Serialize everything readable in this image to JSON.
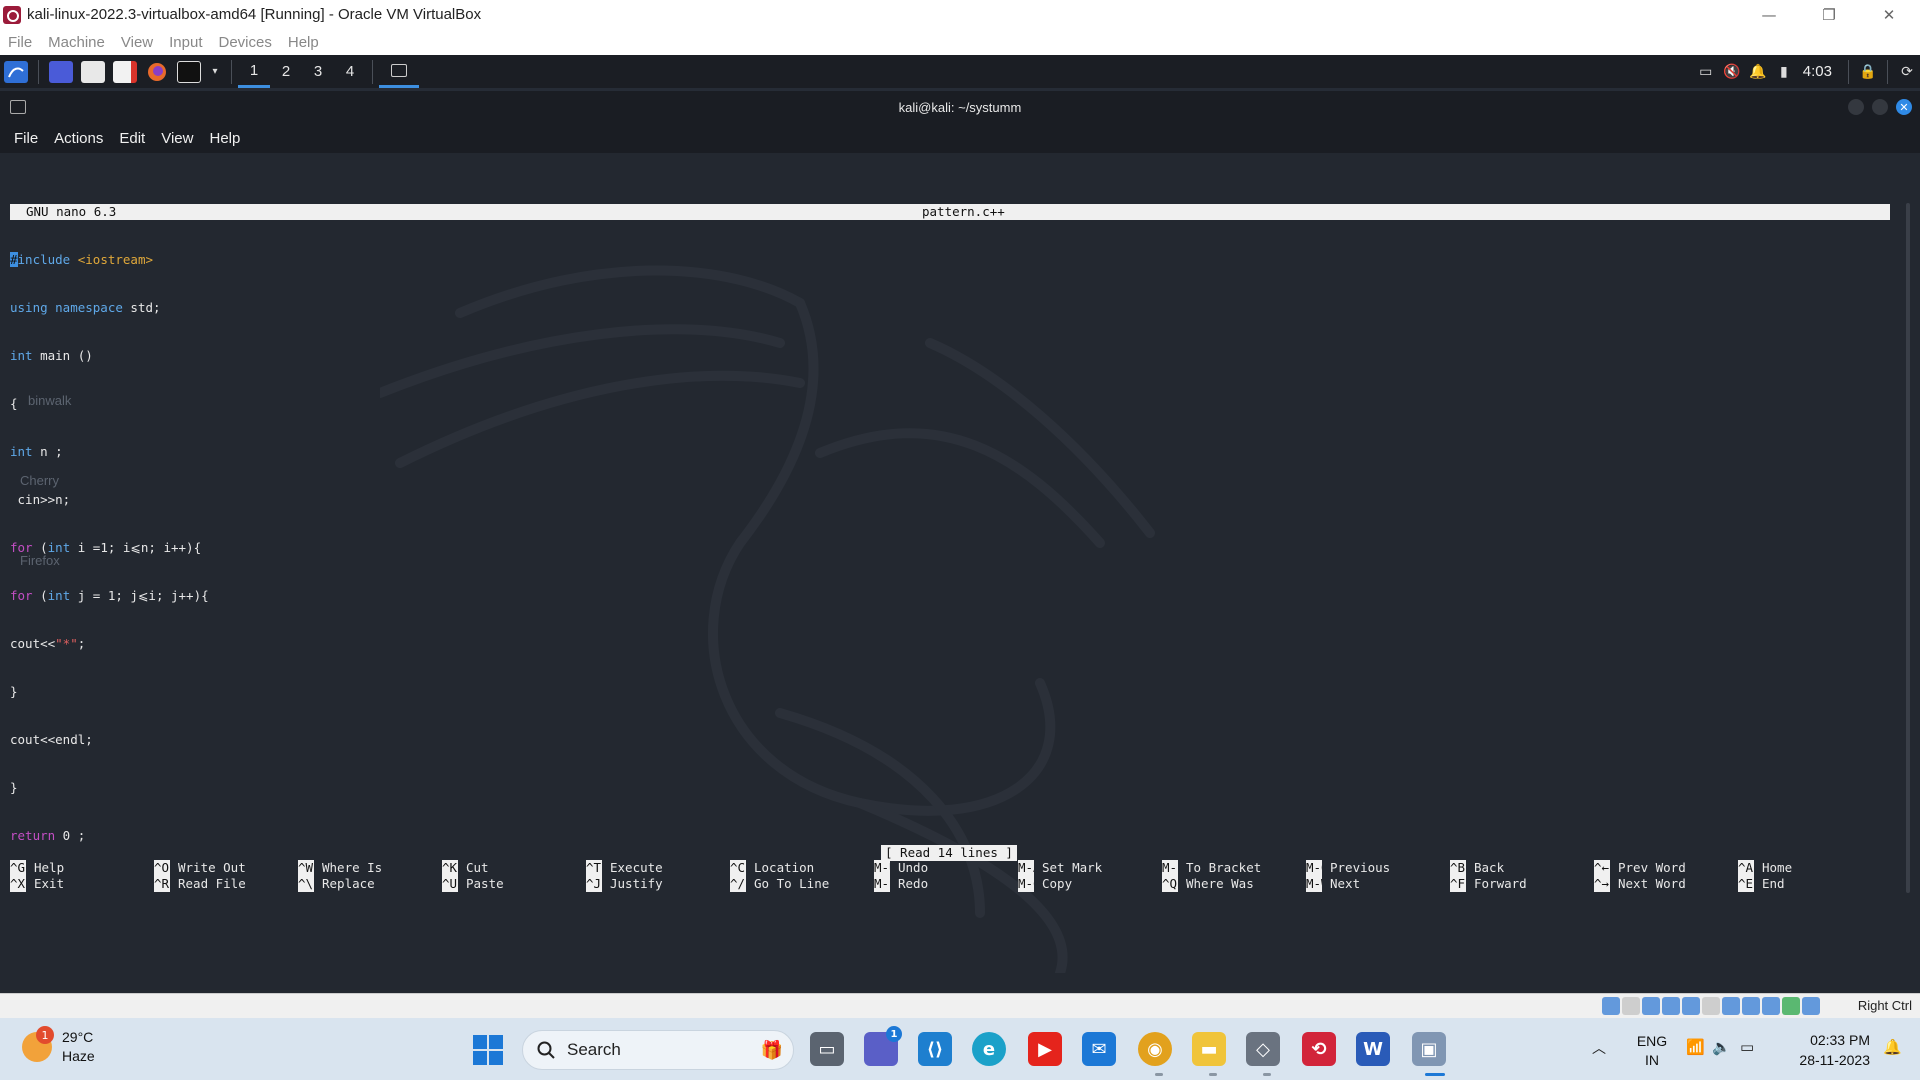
{
  "host": {
    "title": "kali-linux-2022.3-virtualbox-amd64 [Running] - Oracle VM VirtualBox",
    "menu": [
      "File",
      "Machine",
      "View",
      "Input",
      "Devices",
      "Help"
    ],
    "controls": {
      "minimize": "—",
      "restore": "❐",
      "close": "✕"
    },
    "status_right": "Right Ctrl"
  },
  "panel": {
    "workspaces": [
      "1",
      "2",
      "3",
      "4"
    ],
    "active_workspace": "1",
    "clock": "4:03"
  },
  "terminal": {
    "title": "kali@kali: ~/systumm",
    "menu": [
      "File",
      "Actions",
      "Edit",
      "View",
      "Help"
    ]
  },
  "nano": {
    "version": "GNU nano 6.3",
    "filename": "pattern.c++",
    "status": "[ Read 14 lines ]",
    "shortcuts": [
      {
        "k1": "^G",
        "l1": "Help",
        "k2": "^X",
        "l2": "Exit"
      },
      {
        "k1": "^O",
        "l1": "Write Out",
        "k2": "^R",
        "l2": "Read File"
      },
      {
        "k1": "^W",
        "l1": "Where Is",
        "k2": "^\\",
        "l2": "Replace"
      },
      {
        "k1": "^K",
        "l1": "Cut",
        "k2": "^U",
        "l2": "Paste"
      },
      {
        "k1": "^T",
        "l1": "Execute",
        "k2": "^J",
        "l2": "Justify"
      },
      {
        "k1": "^C",
        "l1": "Location",
        "k2": "^/",
        "l2": "Go To Line"
      },
      {
        "k1": "M-U",
        "l1": "Undo",
        "k2": "M-E",
        "l2": "Redo"
      },
      {
        "k1": "M-A",
        "l1": "Set Mark",
        "k2": "M-6",
        "l2": "Copy"
      },
      {
        "k1": "M-]",
        "l1": "To Bracket",
        "k2": "^Q",
        "l2": "Where Was"
      },
      {
        "k1": "M-Q",
        "l1": "Previous",
        "k2": "M-W",
        "l2": "Next"
      },
      {
        "k1": "^B",
        "l1": "Back",
        "k2": "^F",
        "l2": "Forward"
      },
      {
        "k1": "^←",
        "l1": "Prev Word",
        "k2": "^→",
        "l2": "Next Word"
      },
      {
        "k1": "^A",
        "l1": "Home",
        "k2": "^E",
        "l2": "End"
      }
    ]
  },
  "code": {
    "l1a": "#",
    "l1b": "include",
    "l1c": " <iostream>",
    "l2a": "using namespace",
    "l2b": " std;",
    "l3a": "int",
    "l3b": " main ()",
    "l4": "{",
    "l5a": "int",
    "l5b": " n ;",
    "l6": " cin>>n;",
    "l7a": "for",
    "l7b": " (",
    "l7c": "int",
    "l7d": " i =1; i⩽n; i++){",
    "l8a": "for",
    "l8b": " (",
    "l8c": "int",
    "l8d": " j = 1; j⩽i; j++){",
    "l9a": "cout<<",
    "l9b": "\"*\"",
    "l9c": ";",
    "l10": "}",
    "l11": "cout<<endl;",
    "l12": "}",
    "l13a": "return",
    "l13b": " 0 ;",
    "l14": "}"
  },
  "desktop": {
    "icons": [
      "binwalk",
      "Cherry",
      "Firefox"
    ]
  },
  "taskbar": {
    "weather_temp": "29°C",
    "weather_cond": "Haze",
    "weather_badge": "1",
    "search_label": "Search",
    "teams_badge": "1",
    "lang1": "ENG",
    "lang2": "IN",
    "time": "02:33 PM",
    "date": "28-11-2023"
  },
  "colors": {
    "accent": "#3d8fe0",
    "taskbar": "#d9e4ef",
    "terminal_bg": "#232830"
  }
}
